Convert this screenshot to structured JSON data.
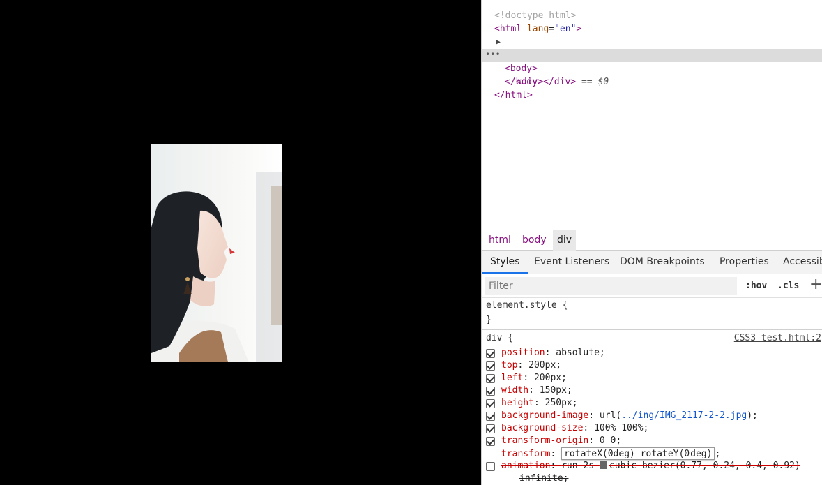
{
  "dom": {
    "line0": "<!doctype html>",
    "html_tag": "html",
    "lang_attr": "lang",
    "lang_val": "\"en\"",
    "head_collapsed": "…",
    "div_tag": "div",
    "eq0": "== $0",
    "dots": "•••"
  },
  "breadcrumbs": [
    "html",
    "body",
    "div"
  ],
  "tabs": [
    "Styles",
    "Event Listeners",
    "DOM Breakpoints",
    "Properties",
    "Accessibi"
  ],
  "filter": {
    "placeholder": "Filter",
    "hov": ":hov",
    "cls": ".cls",
    "add": "+"
  },
  "styles": {
    "element_style_open": "element.style {",
    "close_brace": "}",
    "div_open": "div {",
    "source": "CSS3—test.html:2",
    "props": [
      {
        "name": "position",
        "value": "absolute;",
        "checked": true
      },
      {
        "name": "top",
        "value": "200px;",
        "checked": true
      },
      {
        "name": "left",
        "value": "200px;",
        "checked": true
      },
      {
        "name": "width",
        "value": "150px;",
        "checked": true
      },
      {
        "name": "height",
        "value": "250px;",
        "checked": true
      },
      {
        "name": "background-image",
        "value_prefix": "url(",
        "value_link": "../ing/IMG_2117-2-2.jpg",
        "value_suffix": ");",
        "checked": true
      },
      {
        "name": "background-size",
        "value": "100% 100%;",
        "checked": true
      },
      {
        "name": "transform-origin",
        "value": "0 0;",
        "checked": true
      }
    ],
    "transform": {
      "name": "transform",
      "edit_a": "rotateX(0deg) rotateY(0",
      "edit_b": "deg)",
      "tail": ";"
    },
    "animation": {
      "name": "animation",
      "value_a": "run 2s ",
      "value_b": "cubic-bezier(0.77, 0.24, 0.4, 0.92)",
      "cont": "infinite;"
    }
  },
  "colors": {
    "accent_tab": "#1a73e8",
    "tag": "#881280",
    "prop": "#c80000"
  }
}
